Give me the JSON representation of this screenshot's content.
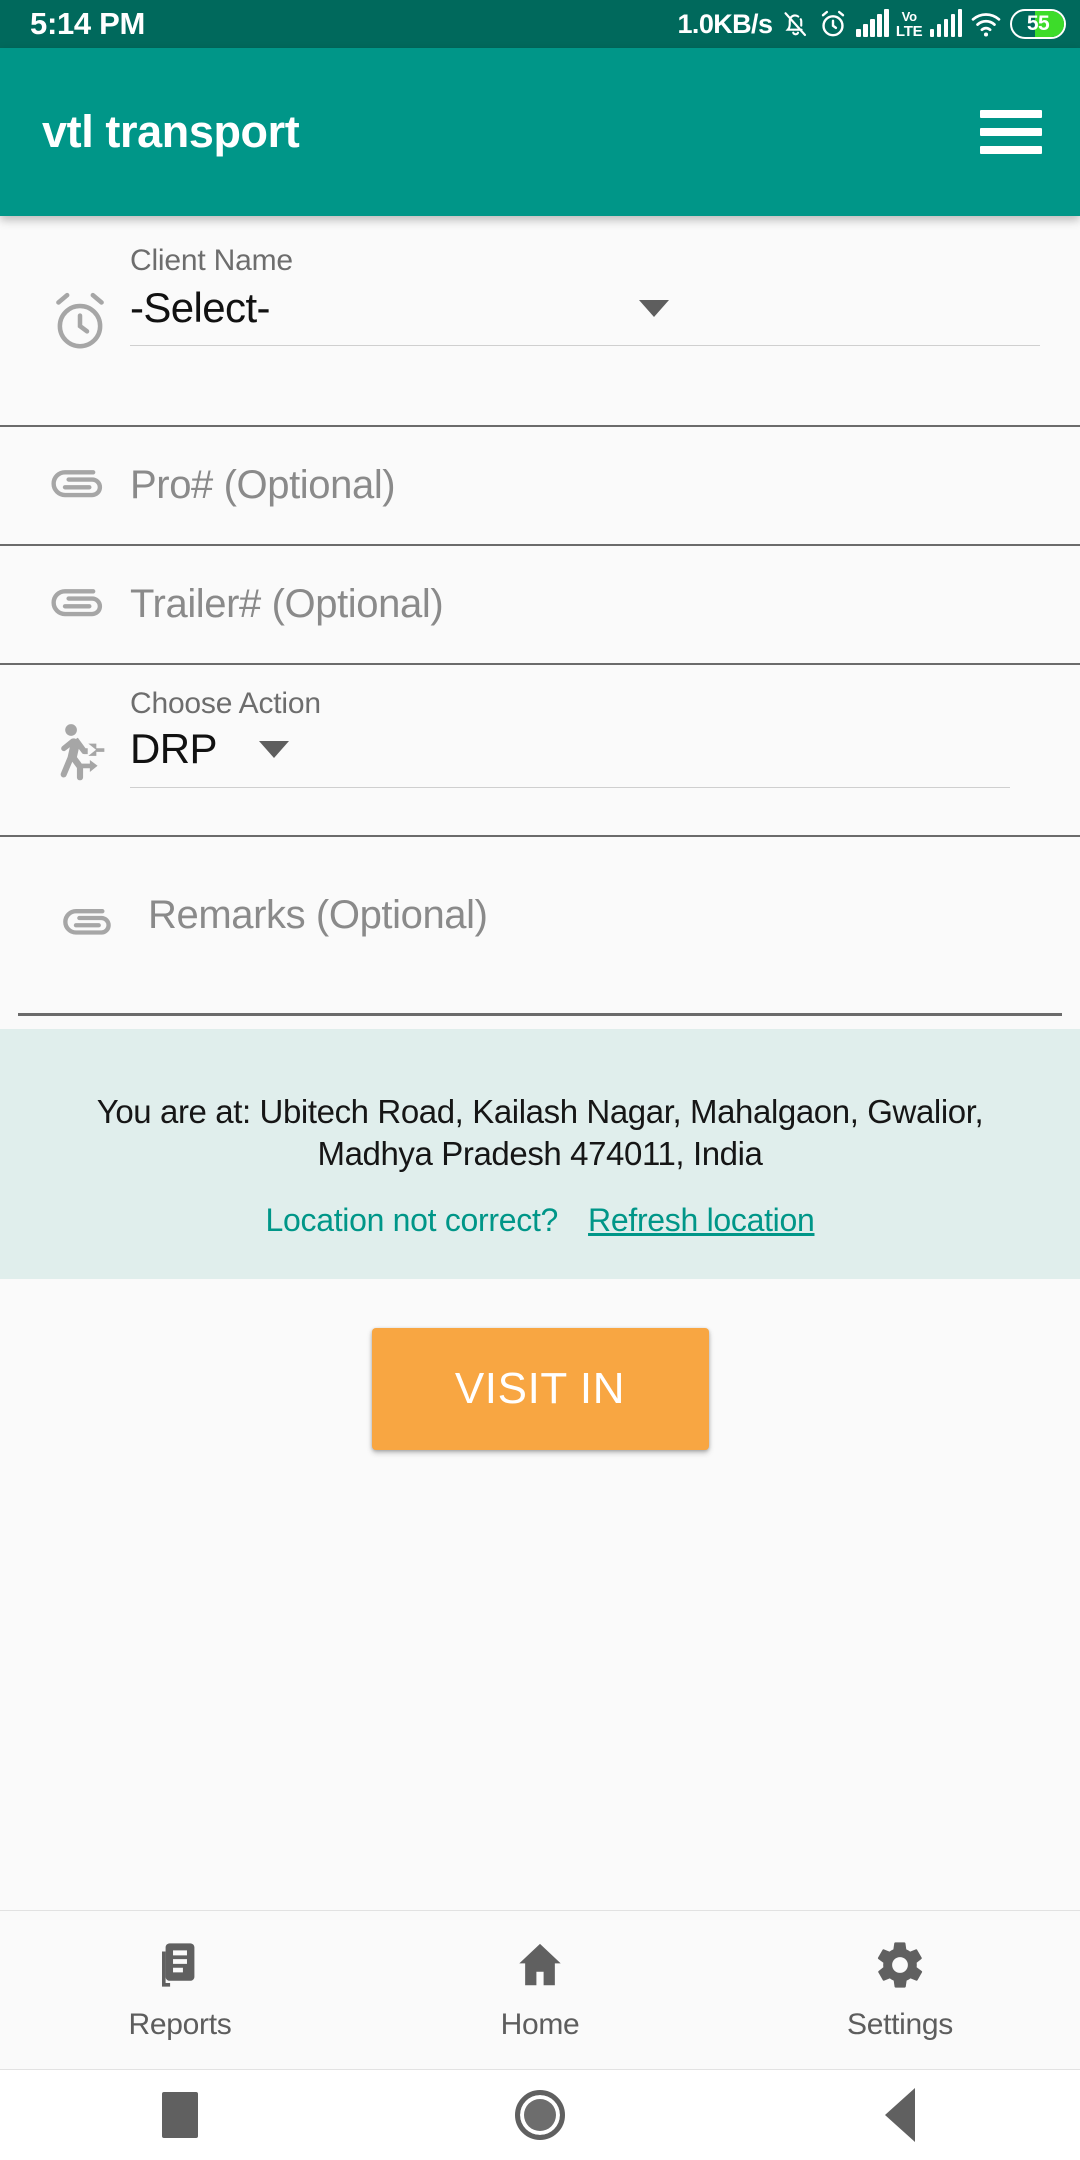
{
  "status_bar": {
    "clock": "5:14 PM",
    "network_speed": "1.0KB/s",
    "icons": [
      "mute-icon",
      "alarm-icon",
      "signal-bars-icon",
      "volte-icon",
      "signal-bars-icon",
      "wifi-icon"
    ],
    "volte_top": "Vo",
    "volte_bottom": "LTE",
    "battery_level": "55",
    "background_color": "#00695c"
  },
  "app_bar": {
    "title": "vtl transport",
    "menu_icon": "hamburger-menu-icon",
    "background_color": "#009688"
  },
  "form": {
    "client": {
      "icon": "alarm-clock-icon",
      "label": "Client Name",
      "value": "-Select-",
      "dropdown_icon": "chevron-down-icon"
    },
    "pro": {
      "icon": "paperclip-icon",
      "placeholder": "Pro# (Optional)",
      "value": ""
    },
    "trailer": {
      "icon": "paperclip-icon",
      "placeholder": "Trailer# (Optional)",
      "value": ""
    },
    "action": {
      "icon": "transfer-within-station-icon",
      "label": "Choose Action",
      "value": "DRP",
      "dropdown_icon": "chevron-down-icon"
    },
    "remarks": {
      "icon": "paperclip-icon",
      "placeholder": "Remarks (Optional)",
      "value": ""
    }
  },
  "location": {
    "text": "You are at: Ubitech Road, Kailash Nagar, Mahalgaon, Gwalior, Madhya Pradesh 474011, India",
    "question": "Location not correct?",
    "refresh_label": "Refresh location",
    "background_color": "#e0eeec",
    "link_color": "#009688"
  },
  "primary_action": {
    "label": "VISIT IN",
    "color": "#f8a642"
  },
  "bottom_nav": {
    "items": [
      {
        "label": "Reports",
        "icon": "library-books-icon"
      },
      {
        "label": "Home",
        "icon": "home-icon"
      },
      {
        "label": "Settings",
        "icon": "gear-icon"
      }
    ]
  },
  "android_nav": {
    "recents": "square-recents-icon",
    "home": "circle-home-icon",
    "back": "triangle-back-icon"
  }
}
